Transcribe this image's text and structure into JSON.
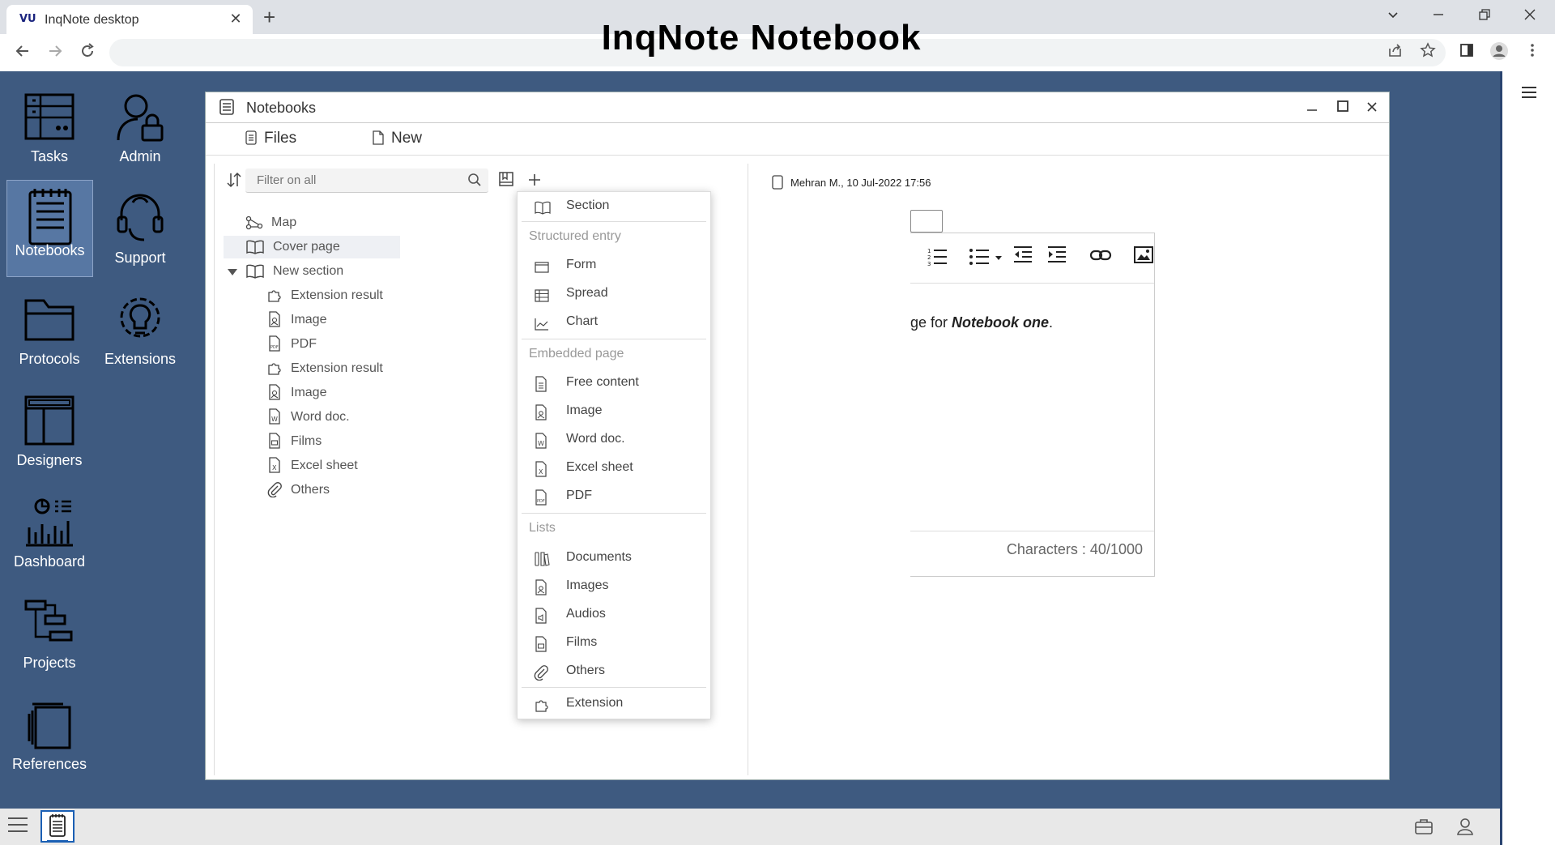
{
  "browser": {
    "tab_title": "InqNote desktop",
    "favicon_text": "VU",
    "close_glyph": "✕",
    "newtab_glyph": "+",
    "page_heading": "InqNote Notebook"
  },
  "desktop_icons": [
    {
      "label": "Tasks",
      "icon": "tasks-icon"
    },
    {
      "label": "Admin",
      "icon": "admin-icon"
    },
    {
      "label": "Notebooks",
      "icon": "notebook-icon"
    },
    {
      "label": "Support",
      "icon": "headset-icon"
    },
    {
      "label": "Protocols",
      "icon": "folder-icon"
    },
    {
      "label": "Extensions",
      "icon": "lightbulb-gear-icon"
    },
    {
      "label": "Designers",
      "icon": "layout-icon"
    },
    {
      "label": "Dashboard",
      "icon": "dashboard-icon"
    },
    {
      "label": "Projects",
      "icon": "projects-icon"
    },
    {
      "label": "References",
      "icon": "references-icon"
    }
  ],
  "window": {
    "title": "Notebooks",
    "menu": {
      "files": "Files",
      "new": "New"
    },
    "filter_placeholder": "Filter on all"
  },
  "tree": [
    {
      "label": "Map",
      "icon": "map-icon"
    },
    {
      "label": "Cover page",
      "icon": "book-icon",
      "selected": true
    },
    {
      "label": "New section",
      "icon": "book-icon",
      "expanded": true
    },
    {
      "label": "Extension result",
      "icon": "puzzle-icon"
    },
    {
      "label": "Image",
      "icon": "image-file-icon"
    },
    {
      "label": "PDF",
      "icon": "pdf-file-icon"
    },
    {
      "label": "Extension result",
      "icon": "puzzle-icon"
    },
    {
      "label": "Image",
      "icon": "image-file-icon"
    },
    {
      "label": "Word doc.",
      "icon": "word-file-icon"
    },
    {
      "label": "Films",
      "icon": "film-file-icon"
    },
    {
      "label": "Excel sheet",
      "icon": "excel-file-icon"
    },
    {
      "label": "Others",
      "icon": "paperclip-icon"
    }
  ],
  "editor": {
    "entry_header": "Mehran M., 10 Jul-2022 17:56",
    "content_prefix": "ge for ",
    "content_bold": "Notebook one",
    "content_suffix": ".",
    "char_count": "Characters : 40/1000"
  },
  "dropdown": {
    "section": "Section",
    "structured_entry_heading": "Structured entry",
    "structured": [
      "Form",
      "Spread",
      "Chart"
    ],
    "embedded_page_heading": "Embedded page",
    "embedded": [
      "Free content",
      "Image",
      "Word doc.",
      "Excel sheet",
      "PDF"
    ],
    "lists_heading": "Lists",
    "lists": [
      "Documents",
      "Images",
      "Audios",
      "Films",
      "Others"
    ],
    "extension": "Extension"
  }
}
